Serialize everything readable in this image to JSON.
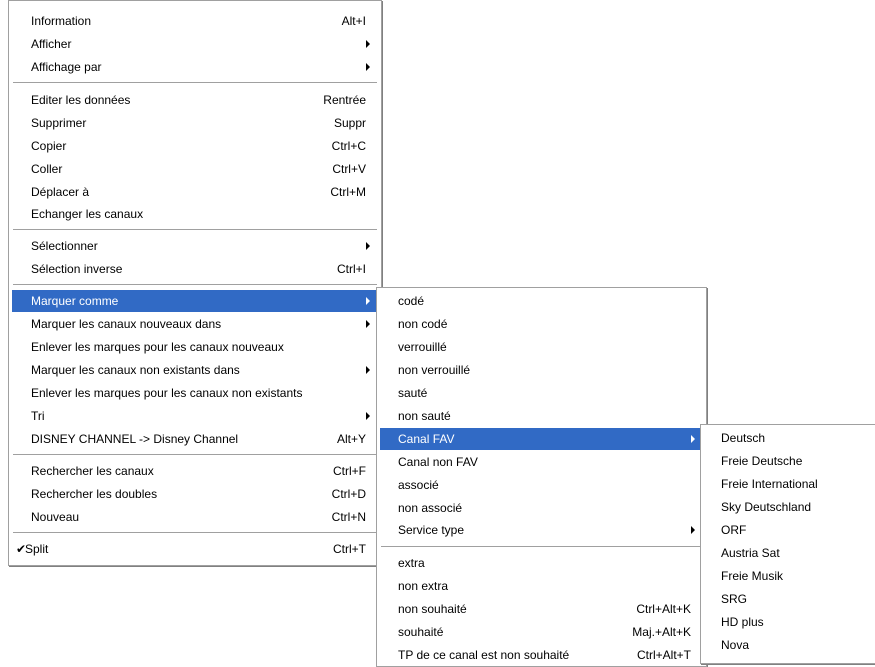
{
  "main_menu": {
    "information": {
      "label": "Information",
      "shortcut": "Alt+I"
    },
    "afficher": {
      "label": "Afficher"
    },
    "affichage_par": {
      "label": "Affichage par"
    },
    "editer": {
      "label": "Editer les données",
      "shortcut": "Rentrée"
    },
    "supprimer": {
      "label": "Supprimer",
      "shortcut": "Suppr"
    },
    "copier": {
      "label": "Copier",
      "shortcut": "Ctrl+C"
    },
    "coller": {
      "label": "Coller",
      "shortcut": "Ctrl+V"
    },
    "deplacer": {
      "label": "Déplacer à",
      "shortcut": "Ctrl+M"
    },
    "echanger": {
      "label": "Echanger les canaux"
    },
    "selectionner": {
      "label": "Sélectionner"
    },
    "selection_inverse": {
      "label": "Sélection inverse",
      "shortcut": "Ctrl+I"
    },
    "marquer_comme": {
      "label": "Marquer comme"
    },
    "marquer_nouveaux": {
      "label": "Marquer les canaux nouveaux dans"
    },
    "enlever_nouveaux": {
      "label": "Enlever les marques pour les canaux nouveaux"
    },
    "marquer_non_existants": {
      "label": "Marquer les canaux non existants dans"
    },
    "enlever_non_existants": {
      "label": "Enlever les marques pour les canaux non existants"
    },
    "tri": {
      "label": "Tri"
    },
    "disney": {
      "label": "DISNEY CHANNEL -> Disney Channel",
      "shortcut": "Alt+Y"
    },
    "rechercher_canaux": {
      "label": "Rechercher les canaux",
      "shortcut": "Ctrl+F"
    },
    "rechercher_doubles": {
      "label": "Rechercher les doubles",
      "shortcut": "Ctrl+D"
    },
    "nouveau": {
      "label": "Nouveau",
      "shortcut": "Ctrl+N"
    },
    "split": {
      "label": "Split",
      "shortcut": "Ctrl+T",
      "check": "✔"
    }
  },
  "marquer_submenu": {
    "code": {
      "label": "codé"
    },
    "non_code": {
      "label": "non codé"
    },
    "verrouille": {
      "label": "verrouillé"
    },
    "non_verrouille": {
      "label": "non verrouillé"
    },
    "saute": {
      "label": "sauté"
    },
    "non_saute": {
      "label": "non sauté"
    },
    "canal_fav": {
      "label": "Canal FAV"
    },
    "canal_non_fav": {
      "label": "Canal non FAV"
    },
    "associe": {
      "label": "associé"
    },
    "non_associe": {
      "label": "non associé"
    },
    "service_type": {
      "label": "Service type"
    },
    "extra": {
      "label": "extra"
    },
    "non_extra": {
      "label": "non extra"
    },
    "non_souhaite": {
      "label": "non souhaité",
      "shortcut": "Ctrl+Alt+K"
    },
    "souhaite": {
      "label": "souhaité",
      "shortcut": "Maj.+Alt+K"
    },
    "tp_non_souhaite": {
      "label": "TP de ce canal est non souhaité",
      "shortcut": "Ctrl+Alt+T"
    }
  },
  "fav_submenu": {
    "items": [
      "Deutsch",
      "Freie Deutsche",
      "Freie International",
      "Sky Deutschland",
      "ORF",
      "Austria Sat",
      "Freie Musik",
      "SRG",
      "HD plus",
      "Nova"
    ]
  },
  "colors": {
    "highlight": "#316ac5",
    "separator": "#a0a0a0"
  }
}
